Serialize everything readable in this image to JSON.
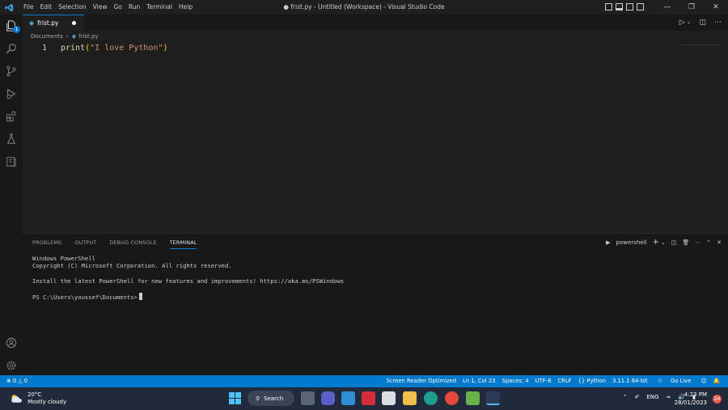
{
  "titlebar": {
    "menu": [
      "File",
      "Edit",
      "Selection",
      "View",
      "Go",
      "Run",
      "Terminal",
      "Help"
    ],
    "title": "● frist.py - Untitled (Workspace) - Visual Studio Code"
  },
  "activitybar": {
    "explorer_badge": "1",
    "icons": [
      "files-icon",
      "search-icon",
      "source-control-icon",
      "run-debug-icon",
      "extensions-icon",
      "testing-icon",
      "remote-explorer-icon",
      "account-icon",
      "settings-gear-icon"
    ]
  },
  "editor": {
    "tab_label": "frist.py",
    "breadcrumb": {
      "folder": "Documents",
      "file": "frist.py"
    },
    "line_number": "1",
    "code": {
      "fn": "print",
      "open": "(",
      "str": "\"I love Python\"",
      "close": ")"
    }
  },
  "panel": {
    "tabs": [
      "PROBLEMS",
      "OUTPUT",
      "DEBUG CONSOLE",
      "TERMINAL"
    ],
    "active_tab": "TERMINAL",
    "terminal_label": "powershell",
    "terminal_lines": [
      "Windows PowerShell",
      "Copyright (C) Microsoft Corporation. All rights reserved.",
      "",
      "Install the latest PowerShell for new features and improvements! https://aka.ms/PSWindows",
      "",
      "PS C:\\Users\\youssef\\Documents>"
    ]
  },
  "statusbar": {
    "errors": "0",
    "warnings": "0",
    "items": [
      "Screen Reader Optimized",
      "Ln 1, Col 23",
      "Spaces: 4",
      "UTF-8",
      "CRLF",
      "{} Python",
      "3.11.1 64-bit",
      "Go Live"
    ]
  },
  "taskbar": {
    "weather_temp": "20°C",
    "weather_desc": "Mostly cloudy",
    "search_label": "Search",
    "language": "ENG",
    "time": "4:23 PM",
    "date": "28/01/2023",
    "notifications": "24"
  },
  "colors": {
    "accent": "#0078d4",
    "statusbar": "#007acc",
    "editor_bg": "#1e1e1e"
  }
}
